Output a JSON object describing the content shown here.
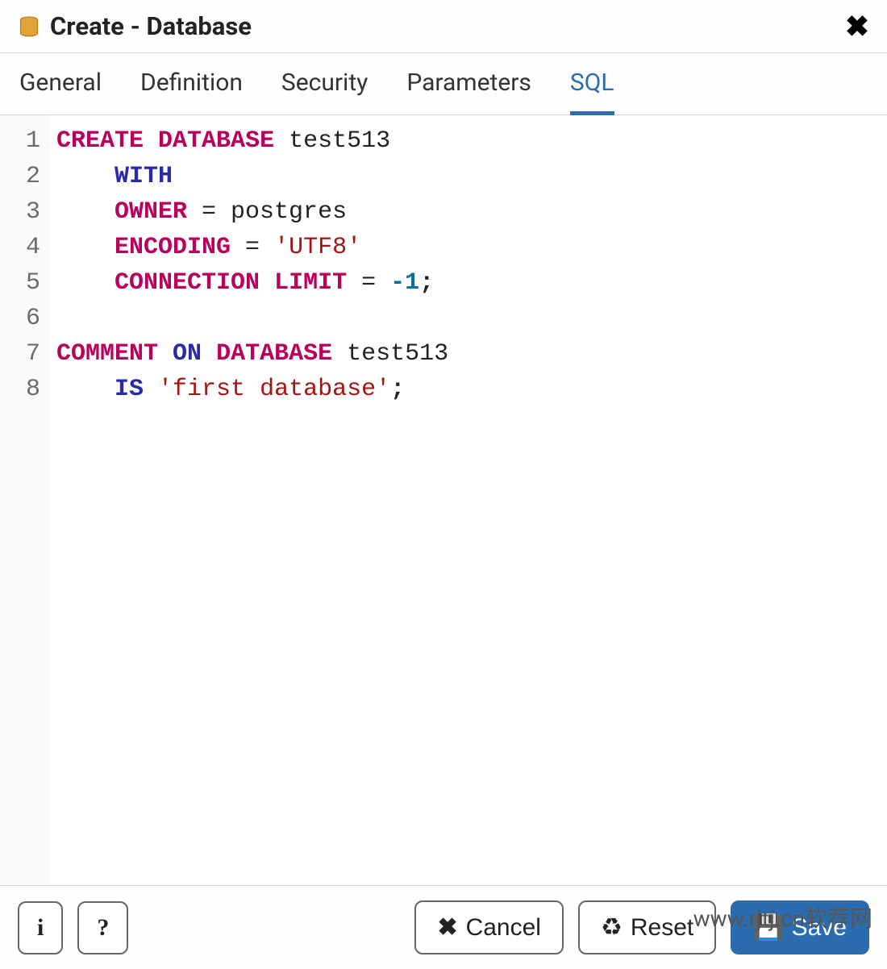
{
  "header": {
    "title": "Create - Database"
  },
  "tabs": [
    {
      "label": "General",
      "active": false
    },
    {
      "label": "Definition",
      "active": false
    },
    {
      "label": "Security",
      "active": false
    },
    {
      "label": "Parameters",
      "active": false
    },
    {
      "label": "SQL",
      "active": true
    }
  ],
  "sql": {
    "lines": [
      {
        "n": "1",
        "tokens": [
          {
            "t": "CREATE",
            "c": "kw-pink"
          },
          {
            "t": " "
          },
          {
            "t": "DATABASE",
            "c": "kw-pink"
          },
          {
            "t": " "
          },
          {
            "t": "test513",
            "c": "ident"
          }
        ]
      },
      {
        "n": "2",
        "tokens": [
          {
            "t": "    "
          },
          {
            "t": "WITH",
            "c": "kw-blue"
          }
        ]
      },
      {
        "n": "3",
        "tokens": [
          {
            "t": "    "
          },
          {
            "t": "OWNER",
            "c": "kw-pink"
          },
          {
            "t": " = "
          },
          {
            "t": "postgres",
            "c": "ident"
          }
        ]
      },
      {
        "n": "4",
        "tokens": [
          {
            "t": "    "
          },
          {
            "t": "ENCODING",
            "c": "kw-pink"
          },
          {
            "t": " = "
          },
          {
            "t": "'UTF8'",
            "c": "str"
          }
        ]
      },
      {
        "n": "5",
        "tokens": [
          {
            "t": "    "
          },
          {
            "t": "CONNECTION",
            "c": "kw-pink"
          },
          {
            "t": " "
          },
          {
            "t": "LIMIT",
            "c": "kw-pink"
          },
          {
            "t": " = "
          },
          {
            "t": "-1",
            "c": "num"
          },
          {
            "t": ";",
            "c": "punct"
          }
        ]
      },
      {
        "n": "6",
        "tokens": [
          {
            "t": " "
          }
        ]
      },
      {
        "n": "7",
        "tokens": [
          {
            "t": "COMMENT",
            "c": "kw-pink"
          },
          {
            "t": " "
          },
          {
            "t": "ON",
            "c": "kw-blue"
          },
          {
            "t": " "
          },
          {
            "t": "DATABASE",
            "c": "kw-pink"
          },
          {
            "t": " "
          },
          {
            "t": "test513",
            "c": "ident"
          }
        ]
      },
      {
        "n": "8",
        "tokens": [
          {
            "t": "    "
          },
          {
            "t": "IS",
            "c": "kw-blue"
          },
          {
            "t": " "
          },
          {
            "t": "'first database'",
            "c": "str"
          },
          {
            "t": ";",
            "c": "punct"
          }
        ]
      }
    ]
  },
  "footer": {
    "info_label": "i",
    "help_label": "?",
    "cancel_label": "Cancel",
    "reset_label": "Reset",
    "save_label": "Save"
  },
  "watermark": "www.rjtj.cn软荐网"
}
